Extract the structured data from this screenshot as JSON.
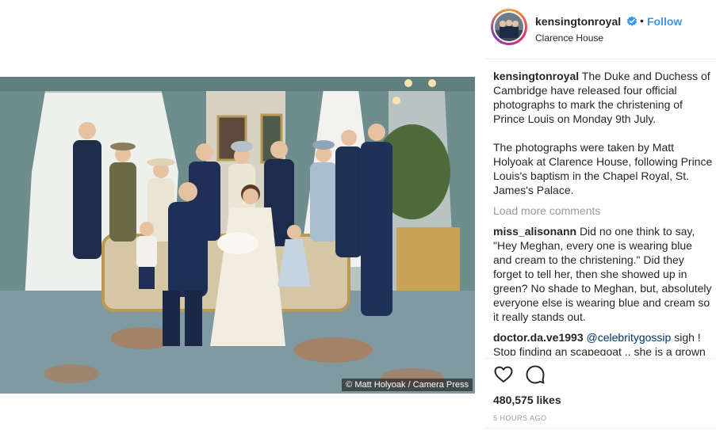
{
  "post": {
    "photo_credit": "© Matt Holyoak / Camera Press"
  },
  "header": {
    "username": "kensingtonroyal",
    "separator": "•",
    "follow_label": "Follow",
    "location": "Clarence House"
  },
  "caption": {
    "username": "kensingtonroyal",
    "paragraph1": "The Duke and Duchess of Cambridge have released four official photographs to mark the christening of Prince Louis on Monday 9th July.",
    "paragraph2": "The photographs were taken by Matt Holyoak at Clarence House, following Prince Louis's baptism in the Chapel Royal, St. James's Palace."
  },
  "load_more_label": "Load more comments",
  "comments": [
    {
      "username": "miss_alisonann",
      "text": "Did no one think to say, \"Hey Meghan, every one is wearing blue and cream to the christening.\" Did they forget to tell her, then she showed up in green? No shade to Meghan, but, absolutely everyone else is wearing blue and cream so it really stands out."
    },
    {
      "username": "doctor.da.ve1993",
      "mention": "@celebritygossip",
      "text": "sigh ! Stop finding an scapegoat .. she is a grown"
    }
  ],
  "likes": "480,575 likes",
  "timestamp": "5 HOURS AGO",
  "icons": {
    "verified": "verified-badge-icon",
    "like": "heart-icon",
    "comment": "comment-bubble-icon"
  },
  "colors": {
    "link": "#3897f0",
    "verified": "#3897f0",
    "muted": "#999999",
    "text": "#262626"
  }
}
